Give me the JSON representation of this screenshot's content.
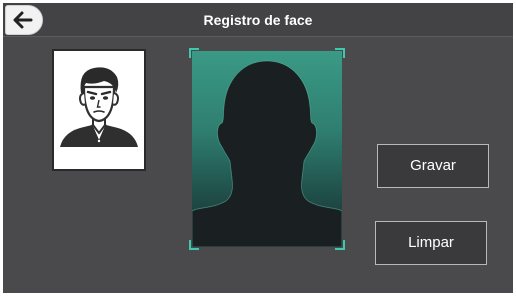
{
  "header": {
    "title": "Registro de face",
    "back_icon": "arrow-left-icon"
  },
  "photo": {
    "icon": "person-portrait-icon"
  },
  "camera": {
    "icon": "face-silhouette-icon",
    "accent_color": "#3ec9aa"
  },
  "actions": {
    "record_label": "Gravar",
    "clear_label": "Limpar"
  },
  "colors": {
    "background": "#4a4a4c",
    "button_background": "#3a3a3c"
  }
}
